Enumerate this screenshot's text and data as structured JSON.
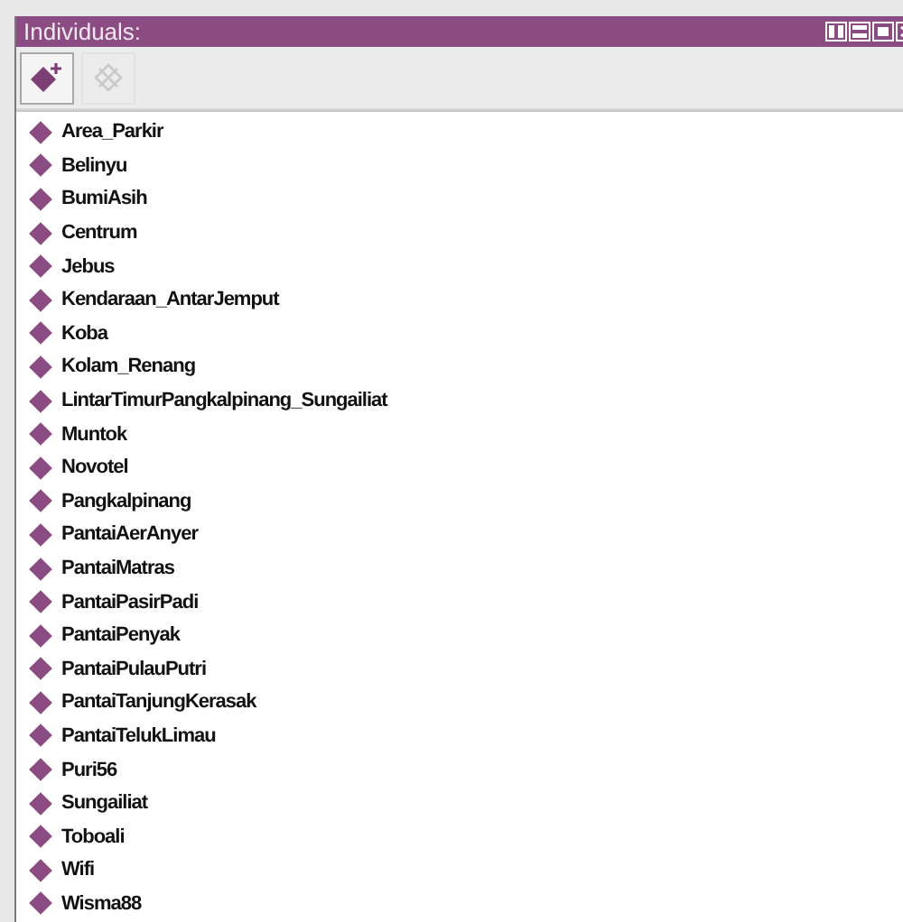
{
  "panel": {
    "title": "Individuals:"
  },
  "toolbar": [
    {
      "kind": "add",
      "disabled": false
    },
    {
      "kind": "delete",
      "disabled": true
    }
  ],
  "individuals": [
    {
      "name": "Area_Parkir"
    },
    {
      "name": "Belinyu"
    },
    {
      "name": "BumiAsih"
    },
    {
      "name": "Centrum"
    },
    {
      "name": "Jebus"
    },
    {
      "name": "Kendaraan_AntarJemput"
    },
    {
      "name": "Koba"
    },
    {
      "name": "Kolam_Renang"
    },
    {
      "name": "LintarTimurPangkalpinang_Sungailiat"
    },
    {
      "name": "Muntok"
    },
    {
      "name": "Novotel"
    },
    {
      "name": "Pangkalpinang"
    },
    {
      "name": "PantaiAerAnyer"
    },
    {
      "name": "PantaiMatras"
    },
    {
      "name": "PantaiPasirPadi"
    },
    {
      "name": "PantaiPenyak"
    },
    {
      "name": "PantaiPulauPutri"
    },
    {
      "name": "PantaiTanjungKerasak"
    },
    {
      "name": "PantaiTelukLimau"
    },
    {
      "name": "Puri56"
    },
    {
      "name": "Sungailiat"
    },
    {
      "name": "Toboali"
    },
    {
      "name": "Wifi"
    },
    {
      "name": "Wisma88"
    }
  ]
}
